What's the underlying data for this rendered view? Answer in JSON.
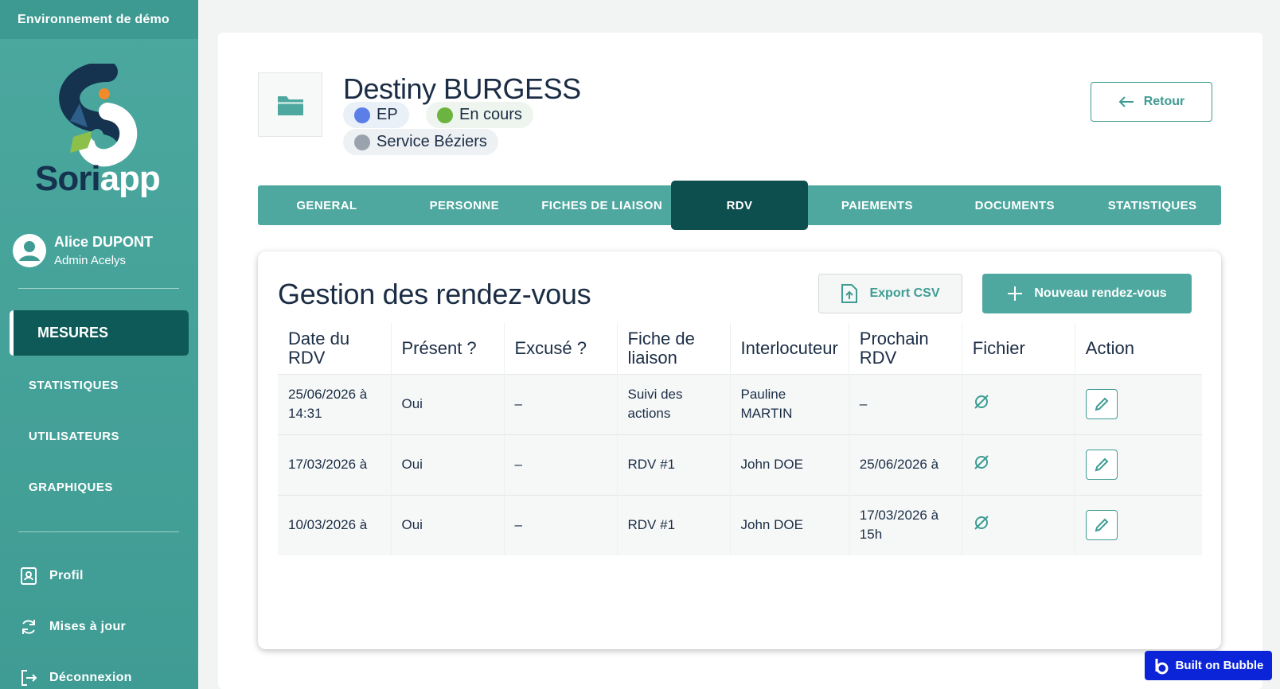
{
  "sidebar": {
    "env_banner": "Environnement de démo",
    "logo_text_main": "Sori",
    "logo_text_accent": "app",
    "user": {
      "name": "Alice DUPONT",
      "role": "Admin Acelys"
    },
    "nav_active": "MESURES",
    "nav_items": [
      "STATISTIQUES",
      "UTILISATEURS",
      "GRAPHIQUES"
    ],
    "bottom_items": [
      {
        "label": "Profil",
        "icon": "profile-icon"
      },
      {
        "label": "Mises à jour",
        "icon": "refresh-icon"
      },
      {
        "label": "Déconnexion",
        "icon": "logout-icon"
      }
    ]
  },
  "header": {
    "person_name": "Destiny BURGESS",
    "badges": [
      {
        "label": "EP",
        "color": "#5b7fe6",
        "bg": "#eaf0f8"
      },
      {
        "label": "En cours",
        "color": "#6db33f",
        "bg": "#eef5ee"
      },
      {
        "label": "Service Béziers",
        "color": "#9aa3ad",
        "bg": "#eef1f3"
      }
    ],
    "retour_label": "Retour"
  },
  "tabs": [
    "GENERAL",
    "PERSONNE",
    "FICHES DE LIAISON",
    "RDV",
    "PAIEMENTS",
    "DOCUMENTS",
    "STATISTIQUES"
  ],
  "active_tab": "RDV",
  "panel": {
    "title": "Gestion des rendez-vous",
    "export_label": "Export CSV",
    "new_label": "Nouveau rendez-vous",
    "columns": [
      "Date du RDV",
      "Présent ?",
      "Excusé ?",
      "Fiche de liaison",
      "Interlocuteur",
      "Prochain RDV",
      "Fichier",
      "Action"
    ],
    "rows": [
      {
        "date": "25/06/2026 à 14:31",
        "present": "Oui",
        "excuse": "–",
        "fiche": "Suivi des actions",
        "interlocuteur": "Pauline MARTIN",
        "prochain": "–"
      },
      {
        "date": "17/03/2026 à",
        "present": "Oui",
        "excuse": "–",
        "fiche": "RDV #1",
        "interlocuteur": "John DOE",
        "prochain": "25/06/2026 à"
      },
      {
        "date": "10/03/2026 à",
        "present": "Oui",
        "excuse": "–",
        "fiche": "RDV #1",
        "interlocuteur": "John DOE",
        "prochain": "17/03/2026 à 15h"
      }
    ]
  },
  "footer_badge": "Built on Bubble",
  "colors": {
    "teal": "#4ea89f",
    "dark_teal": "#0d4f4e",
    "navy": "#1b2d45",
    "bubble_blue": "#0b24d8"
  }
}
